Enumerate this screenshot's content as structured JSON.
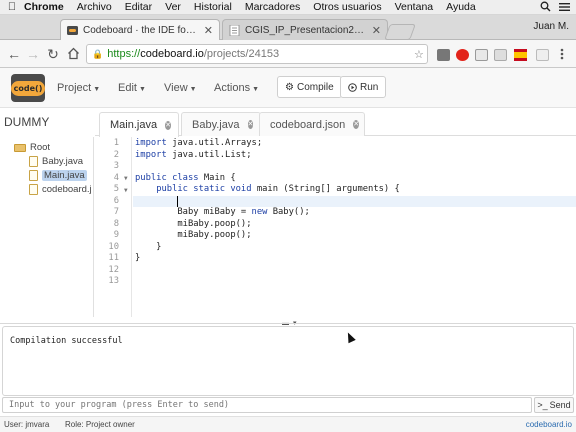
{
  "menubar": {
    "items": [
      "Chrome",
      "Archivo",
      "Editar",
      "Ver",
      "Historial",
      "Marcadores",
      "Otros usuarios",
      "Ventana",
      "Ayuda"
    ]
  },
  "tabs": [
    {
      "title": "Codeboard · the IDE for the cl"
    },
    {
      "title": "CGIS_IP_Presentacion2016_V"
    }
  ],
  "browser": {
    "user": "Juan M.",
    "url_protocol": "https://",
    "url_host": "codeboard.io",
    "url_path": "/projects/24153"
  },
  "app": {
    "logo_text": "code()",
    "menus": [
      "Project",
      "Edit",
      "View",
      "Actions"
    ],
    "compile_label": "Compile",
    "run_label": "Run"
  },
  "project": {
    "name": "DUMMY",
    "tree": [
      "Root",
      "Baby.java",
      "Main.java",
      "codeboard.j"
    ]
  },
  "editor_tabs": [
    "Main.java",
    "Baby.java",
    "codeboard.json"
  ],
  "editor": {
    "line_numbers": [
      "1",
      "2",
      "3",
      "4",
      "5",
      "6",
      "7",
      "8",
      "9",
      "10",
      "11",
      "12",
      "13"
    ],
    "lines": [
      "import java.util.Arrays;",
      "import java.util.List;",
      "",
      "public class Main {",
      "    public static void main (String[] arguments) {",
      "",
      "        Baby miBaby = new Baby();",
      "        miBaby.poop();",
      "        miBaby.poop();",
      "    }",
      "}",
      "",
      ""
    ]
  },
  "console": {
    "output": "Compilation successful",
    "input_placeholder": "Input to your program (press Enter to send)",
    "send_label": "Send"
  },
  "status": {
    "user": "User: jmvara",
    "role": "Role: Project owner",
    "brand": "codeboard.io"
  }
}
